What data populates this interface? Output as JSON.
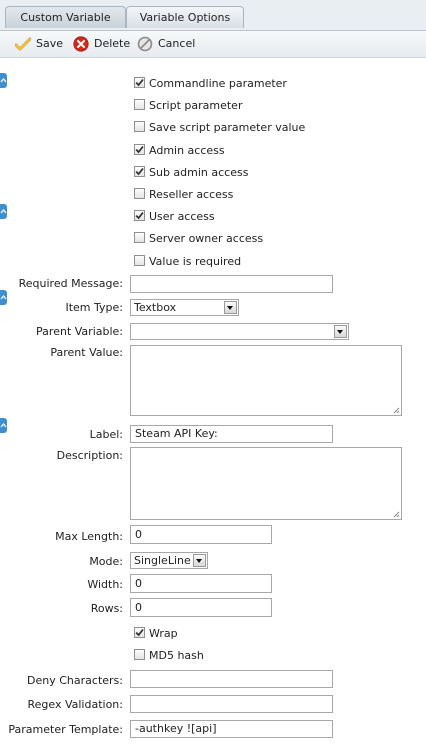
{
  "tabs": [
    {
      "label": "Custom Variable"
    },
    {
      "label": "Variable Options"
    }
  ],
  "toolbar": {
    "save_label": "Save",
    "delete_label": "Delete",
    "cancel_label": "Cancel"
  },
  "options": [
    {
      "label": "Commandline parameter",
      "checked": true
    },
    {
      "label": "Script parameter",
      "checked": false
    },
    {
      "label": "Save script parameter value",
      "checked": false
    },
    {
      "label": "Admin access",
      "checked": true
    },
    {
      "label": "Sub admin access",
      "checked": true
    },
    {
      "label": "Reseller access",
      "checked": false
    },
    {
      "label": "User access",
      "checked": true
    },
    {
      "label": "Server owner access",
      "checked": false
    },
    {
      "label": "Value is required",
      "checked": false
    }
  ],
  "form": {
    "required_message_label": "Required Message:",
    "required_message_value": "",
    "item_type_label": "Item Type:",
    "item_type_value": "Textbox",
    "parent_variable_label": "Parent Variable:",
    "parent_variable_value": "",
    "parent_value_label": "Parent Value:",
    "label_label": "Label:",
    "label_value": "Steam API Key:",
    "description_label": "Description:",
    "max_length_label": "Max Length:",
    "max_length_value": "0",
    "mode_label": "Mode:",
    "mode_value": "SingleLine",
    "width_label": "Width:",
    "width_value": "0",
    "rows_label": "Rows:",
    "rows_value": "0",
    "wrap_label": "Wrap",
    "wrap_checked": true,
    "md5_label": "MD5 hash",
    "md5_checked": false,
    "deny_characters_label": "Deny Characters:",
    "deny_characters_value": "",
    "regex_validation_label": "Regex Validation:",
    "regex_validation_value": "",
    "parameter_template_label": "Parameter Template:",
    "parameter_template_value": "-authkey ![api]"
  }
}
